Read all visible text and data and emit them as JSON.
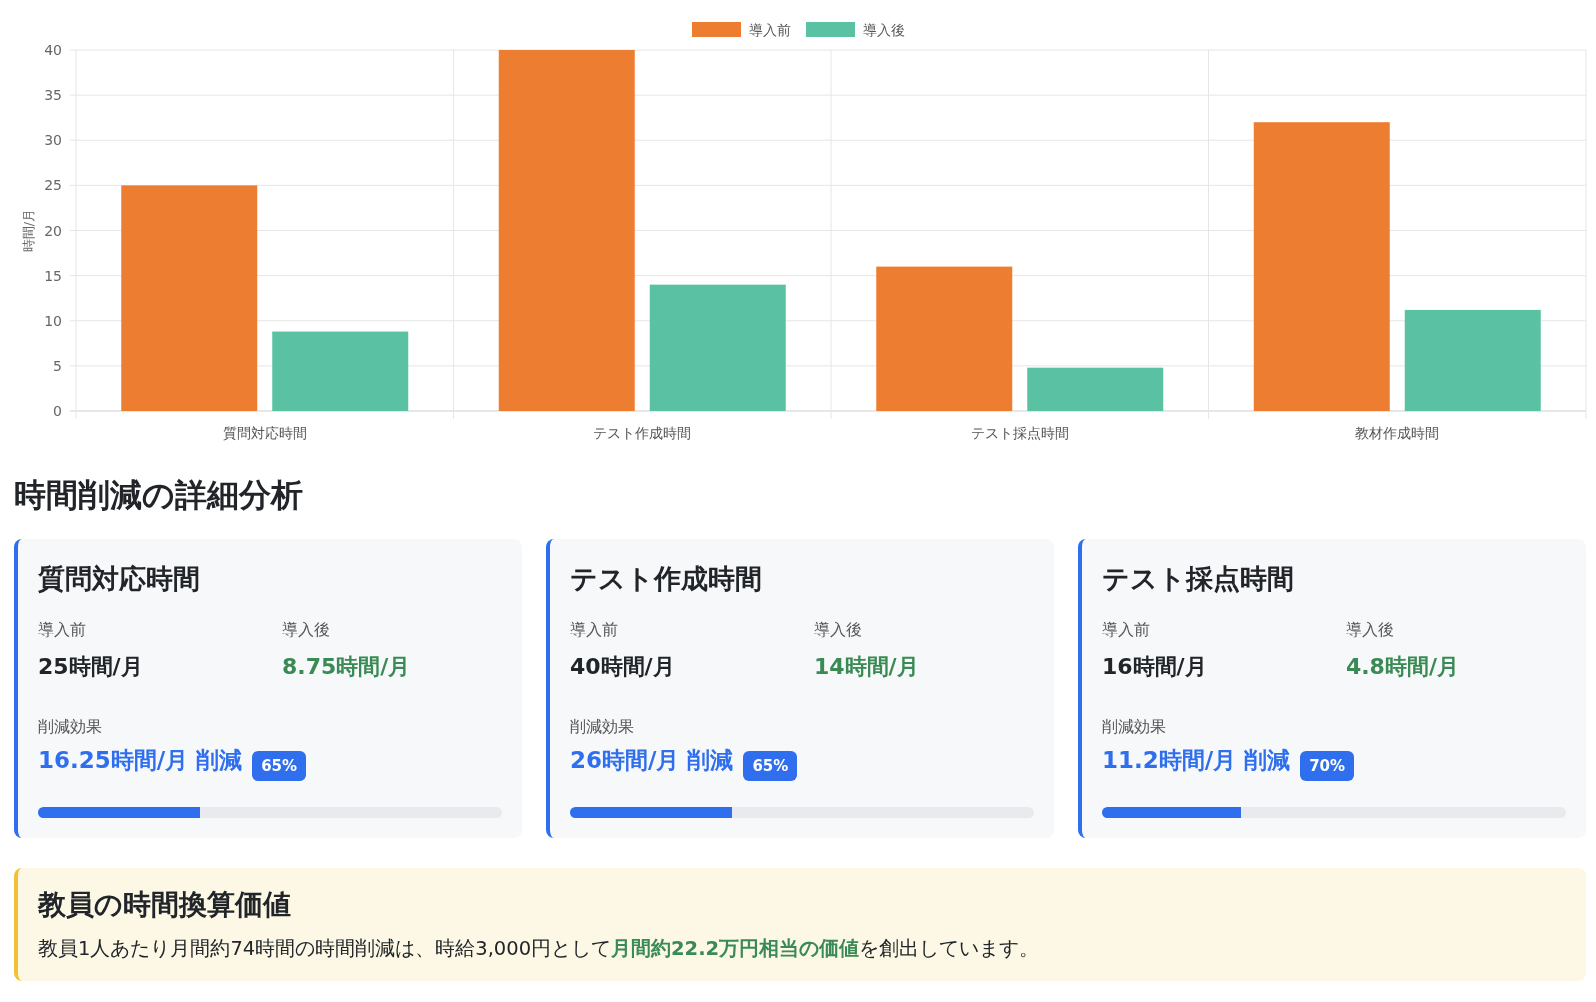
{
  "chart": {
    "chart_data": {
      "type": "bar",
      "grid": true,
      "legend": true,
      "ylabel": "時間/月",
      "categories": [
        "質問対応時間",
        "テスト作成時間",
        "テスト採点時間",
        "教材作成時間"
      ],
      "series": [
        {
          "name": "導入前",
          "color": "#ed7d31",
          "values": [
            25,
            40,
            16,
            32
          ]
        },
        {
          "name": "導入後",
          "color": "#5ac2a2",
          "values": [
            8.8,
            14,
            4.8,
            11.2
          ]
        }
      ],
      "ylim": [
        0,
        40
      ],
      "yticks": [
        0,
        5,
        10,
        15,
        20,
        25,
        30,
        35,
        40
      ]
    }
  },
  "section_title": "時間削減の詳細分析",
  "cards": [
    {
      "title": "質問対応時間",
      "before_label": "導入前",
      "before_value": "25時間/月",
      "after_label": "導入後",
      "after_value": "8.75時間/月",
      "reduction_label": "削減効果",
      "reduction_value": "16.25時間/月 削減",
      "percent": "65%",
      "level": 0.35
    },
    {
      "title": "テスト作成時間",
      "before_label": "導入前",
      "before_value": "40時間/月",
      "after_label": "導入後",
      "after_value": "14時間/月",
      "reduction_label": "削減効果",
      "reduction_value": "26時間/月 削減",
      "percent": "65%",
      "level": 0.35
    },
    {
      "title": "テスト採点時間",
      "before_label": "導入前",
      "before_value": "16時間/月",
      "after_label": "導入後",
      "after_value": "4.8時間/月",
      "reduction_label": "削減効果",
      "reduction_value": "11.2時間/月 削減",
      "percent": "70%",
      "level": 0.3
    }
  ],
  "value_box": {
    "title": "教員の時間換算価値",
    "text": "教員1人あたり月間約74時間の時間削減は、時給3,000円として**月間約22.2万円相当の価値**を創出しています。"
  }
}
